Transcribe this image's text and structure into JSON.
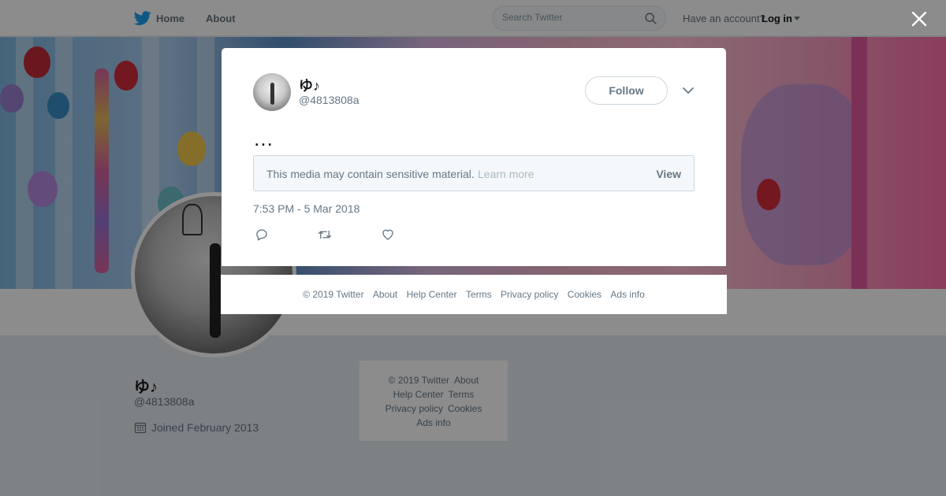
{
  "topbar": {
    "home_label": "Home",
    "about_label": "About",
    "search_placeholder": "Search Twitter",
    "have_account_label": "Have an account?",
    "login_label": "Log in"
  },
  "profile": {
    "name": "ゆ♪",
    "handle": "@4813808a",
    "joined": "Joined February 2013"
  },
  "side_footer": {
    "copyright": "© 2019 Twitter",
    "links": [
      "About",
      "Help Center",
      "Terms",
      "Privacy policy",
      "Cookies",
      "Ads info"
    ]
  },
  "tweet": {
    "name": "ゆ♪",
    "handle": "@4813808a",
    "follow_label": "Follow",
    "text": "…",
    "sensitive_message": "This media may contain sensitive material.",
    "learn_more": "Learn more",
    "view_label": "View",
    "timestamp": "7:53 PM - 5 Mar 2018"
  },
  "modal_footer": {
    "copyright": "© 2019 Twitter",
    "links": [
      "About",
      "Help Center",
      "Terms",
      "Privacy policy",
      "Cookies",
      "Ads info"
    ]
  },
  "icons": {
    "logo": "twitter-bird-icon",
    "search": "magnifier-icon",
    "close": "close-icon",
    "more": "chevron-down-icon",
    "reply": "reply-icon",
    "retweet": "retweet-icon",
    "like": "heart-icon",
    "calendar": "calendar-icon"
  },
  "colors": {
    "brand": "#1da1f2",
    "text_primary": "#14171a",
    "text_secondary": "#657786",
    "overlay": "rgba(0,0,0,0.45)"
  }
}
